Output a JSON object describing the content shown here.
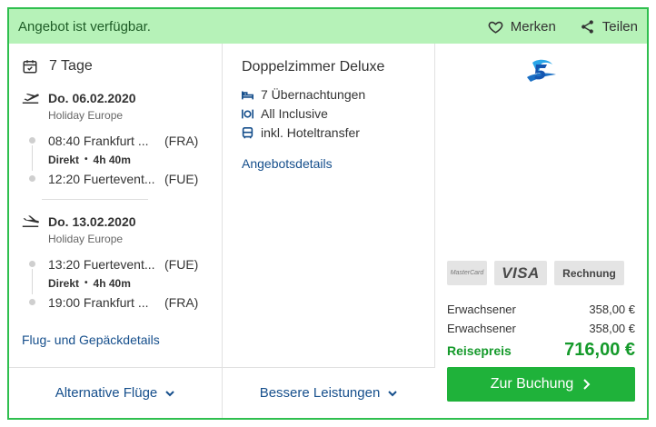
{
  "banner": {
    "title": "Angebot ist verfügbar.",
    "save_label": "Merken",
    "share_label": "Teilen"
  },
  "flight": {
    "duration": "7 Tage",
    "outbound": {
      "date": "Do. 06.02.2020",
      "airline": "Holiday Europe",
      "depart_time": "08:40 Frankfurt ...",
      "depart_code": "(FRA)",
      "direct_label": "Direkt",
      "flight_duration": "4h 40m",
      "arrive_time": "12:20 Fuertevent...",
      "arrive_code": "(FUE)"
    },
    "inbound": {
      "date": "Do. 13.02.2020",
      "airline": "Holiday Europe",
      "depart_time": "13:20 Fuertevent...",
      "depart_code": "(FUE)",
      "direct_label": "Direkt",
      "flight_duration": "4h 40m",
      "arrive_time": "19:00 Frankfurt ...",
      "arrive_code": "(FRA)"
    },
    "details_link": "Flug- und Gepäckdetails"
  },
  "room": {
    "title": "Doppelzimmer Deluxe",
    "features": [
      "7 Übernachtungen",
      "All Inclusive",
      "inkl. Hoteltransfer"
    ],
    "details_link": "Angebotsdetails"
  },
  "price": {
    "payment": {
      "mastercard": "MasterCard",
      "visa": "VISA",
      "invoice": "Rechnung"
    },
    "lines": [
      {
        "label": "Erwachsener",
        "value": "358,00 €"
      },
      {
        "label": "Erwachsener",
        "value": "358,00 €"
      }
    ],
    "total_label": "Reisepreis",
    "total_value": "716,00 €",
    "book_label": "Zur Buchung"
  },
  "bottom": {
    "alt_flights": "Alternative Flüge",
    "better_services": "Bessere Leistungen"
  },
  "colors": {
    "accent_green": "#1fb23a",
    "banner_bg": "#b6f2b8",
    "link_blue": "#164f8c"
  }
}
